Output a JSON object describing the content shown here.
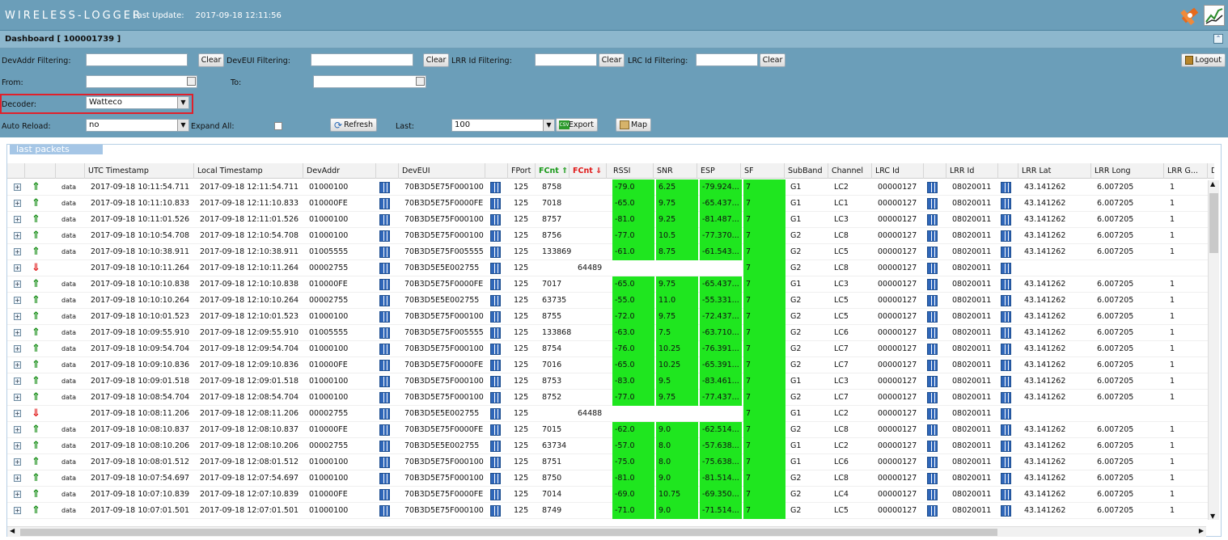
{
  "app": {
    "title": "WIRELESS-LOGGER",
    "last_update_label": "Last Update:",
    "last_update_value": "2017-09-18 12:11:56"
  },
  "dashboard": {
    "title": "Dashboard [ 100001739 ]"
  },
  "filters": {
    "devaddr_label": "DevAddr Filtering:",
    "devaddr_value": "",
    "deveui_label": "DevEUI Filtering:",
    "deveui_value": "",
    "lrr_label": "LRR Id Filtering:",
    "lrr_value": "",
    "lrc_label": "LRC Id Filtering:",
    "lrc_value": "",
    "clear_label": "Clear",
    "logout_label": "Logout",
    "from_label": "From:",
    "from_value": "",
    "to_label": "To:",
    "to_value": "",
    "decoder_label": "Decoder:",
    "decoder_value": "Watteco",
    "auto_reload_label": "Auto Reload:",
    "auto_reload_value": "no",
    "expand_all_label": "Expand All:",
    "refresh_label": "Refresh",
    "last_label": "Last:",
    "last_value": "100",
    "export_label": "Export",
    "map_label": "Map"
  },
  "panel": {
    "title": "last packets"
  },
  "columns": [
    "UTC Timestamp",
    "Local Timestamp",
    "DevAddr",
    "DevEUI",
    "FPort",
    "FCnt ⇑",
    "FCnt ⇓",
    "RSSI",
    "SNR",
    "ESP",
    "SF",
    "SubBand",
    "Channel",
    "LRC Id",
    "LRR Id",
    "LRR Lat",
    "LRR Long",
    "LRR G...",
    "Dev"
  ],
  "rows": [
    {
      "dir": "up",
      "tag": "data",
      "utc": "2017-09-18 10:11:54.711",
      "local": "2017-09-18 12:11:54.711",
      "devaddr": "01000100",
      "deveui": "70B3D5E75F000100",
      "fport": "125",
      "fcnt_up": "8758",
      "fcnt_down": "",
      "rssi": "-79.0",
      "snr": "6.25",
      "esp": "-79.924...",
      "sf": "7",
      "subband": "G1",
      "channel": "LC2",
      "lrc": "00000127",
      "lrr": "08020011",
      "lat": "43.141262",
      "lon": "6.007205",
      "lrrg": "1"
    },
    {
      "dir": "up",
      "tag": "data",
      "utc": "2017-09-18 10:11:10.833",
      "local": "2017-09-18 12:11:10.833",
      "devaddr": "010000FE",
      "deveui": "70B3D5E75F0000FE",
      "fport": "125",
      "fcnt_up": "7018",
      "fcnt_down": "",
      "rssi": "-65.0",
      "snr": "9.75",
      "esp": "-65.437...",
      "sf": "7",
      "subband": "G1",
      "channel": "LC1",
      "lrc": "00000127",
      "lrr": "08020011",
      "lat": "43.141262",
      "lon": "6.007205",
      "lrrg": "1"
    },
    {
      "dir": "up",
      "tag": "data",
      "utc": "2017-09-18 10:11:01.526",
      "local": "2017-09-18 12:11:01.526",
      "devaddr": "01000100",
      "deveui": "70B3D5E75F000100",
      "fport": "125",
      "fcnt_up": "8757",
      "fcnt_down": "",
      "rssi": "-81.0",
      "snr": "9.25",
      "esp": "-81.487...",
      "sf": "7",
      "subband": "G1",
      "channel": "LC3",
      "lrc": "00000127",
      "lrr": "08020011",
      "lat": "43.141262",
      "lon": "6.007205",
      "lrrg": "1"
    },
    {
      "dir": "up",
      "tag": "data",
      "utc": "2017-09-18 10:10:54.708",
      "local": "2017-09-18 12:10:54.708",
      "devaddr": "01000100",
      "deveui": "70B3D5E75F000100",
      "fport": "125",
      "fcnt_up": "8756",
      "fcnt_down": "",
      "rssi": "-77.0",
      "snr": "10.5",
      "esp": "-77.370...",
      "sf": "7",
      "subband": "G2",
      "channel": "LC8",
      "lrc": "00000127",
      "lrr": "08020011",
      "lat": "43.141262",
      "lon": "6.007205",
      "lrrg": "1"
    },
    {
      "dir": "up",
      "tag": "data",
      "utc": "2017-09-18 10:10:38.911",
      "local": "2017-09-18 12:10:38.911",
      "devaddr": "01005555",
      "deveui": "70B3D5E75F005555",
      "fport": "125",
      "fcnt_up": "133869",
      "fcnt_down": "",
      "rssi": "-61.0",
      "snr": "8.75",
      "esp": "-61.543...",
      "sf": "7",
      "subband": "G2",
      "channel": "LC5",
      "lrc": "00000127",
      "lrr": "08020011",
      "lat": "43.141262",
      "lon": "6.007205",
      "lrrg": "1"
    },
    {
      "dir": "down",
      "tag": "",
      "utc": "2017-09-18 10:10:11.264",
      "local": "2017-09-18 12:10:11.264",
      "devaddr": "00002755",
      "deveui": "70B3D5E5E002755",
      "fport": "125",
      "fcnt_up": "",
      "fcnt_down": "64489",
      "rssi": "",
      "snr": "",
      "esp": "",
      "sf": "7",
      "subband": "G2",
      "channel": "LC8",
      "lrc": "00000127",
      "lrr": "08020011",
      "lat": "",
      "lon": "",
      "lrrg": ""
    },
    {
      "dir": "up",
      "tag": "data",
      "utc": "2017-09-18 10:10:10.838",
      "local": "2017-09-18 12:10:10.838",
      "devaddr": "010000FE",
      "deveui": "70B3D5E75F0000FE",
      "fport": "125",
      "fcnt_up": "7017",
      "fcnt_down": "",
      "rssi": "-65.0",
      "snr": "9.75",
      "esp": "-65.437...",
      "sf": "7",
      "subband": "G1",
      "channel": "LC3",
      "lrc": "00000127",
      "lrr": "08020011",
      "lat": "43.141262",
      "lon": "6.007205",
      "lrrg": "1"
    },
    {
      "dir": "up",
      "tag": "data",
      "utc": "2017-09-18 10:10:10.264",
      "local": "2017-09-18 12:10:10.264",
      "devaddr": "00002755",
      "deveui": "70B3D5E5E002755",
      "fport": "125",
      "fcnt_up": "63735",
      "fcnt_down": "",
      "rssi": "-55.0",
      "snr": "11.0",
      "esp": "-55.331...",
      "sf": "7",
      "subband": "G2",
      "channel": "LC5",
      "lrc": "00000127",
      "lrr": "08020011",
      "lat": "43.141262",
      "lon": "6.007205",
      "lrrg": "1"
    },
    {
      "dir": "up",
      "tag": "data",
      "utc": "2017-09-18 10:10:01.523",
      "local": "2017-09-18 12:10:01.523",
      "devaddr": "01000100",
      "deveui": "70B3D5E75F000100",
      "fport": "125",
      "fcnt_up": "8755",
      "fcnt_down": "",
      "rssi": "-72.0",
      "snr": "9.75",
      "esp": "-72.437...",
      "sf": "7",
      "subband": "G2",
      "channel": "LC5",
      "lrc": "00000127",
      "lrr": "08020011",
      "lat": "43.141262",
      "lon": "6.007205",
      "lrrg": "1"
    },
    {
      "dir": "up",
      "tag": "data",
      "utc": "2017-09-18 10:09:55.910",
      "local": "2017-09-18 12:09:55.910",
      "devaddr": "01005555",
      "deveui": "70B3D5E75F005555",
      "fport": "125",
      "fcnt_up": "133868",
      "fcnt_down": "",
      "rssi": "-63.0",
      "snr": "7.5",
      "esp": "-63.710...",
      "sf": "7",
      "subband": "G2",
      "channel": "LC6",
      "lrc": "00000127",
      "lrr": "08020011",
      "lat": "43.141262",
      "lon": "6.007205",
      "lrrg": "1"
    },
    {
      "dir": "up",
      "tag": "data",
      "utc": "2017-09-18 10:09:54.704",
      "local": "2017-09-18 12:09:54.704",
      "devaddr": "01000100",
      "deveui": "70B3D5E75F000100",
      "fport": "125",
      "fcnt_up": "8754",
      "fcnt_down": "",
      "rssi": "-76.0",
      "snr": "10.25",
      "esp": "-76.391...",
      "sf": "7",
      "subband": "G2",
      "channel": "LC7",
      "lrc": "00000127",
      "lrr": "08020011",
      "lat": "43.141262",
      "lon": "6.007205",
      "lrrg": "1"
    },
    {
      "dir": "up",
      "tag": "data",
      "utc": "2017-09-18 10:09:10.836",
      "local": "2017-09-18 12:09:10.836",
      "devaddr": "010000FE",
      "deveui": "70B3D5E75F0000FE",
      "fport": "125",
      "fcnt_up": "7016",
      "fcnt_down": "",
      "rssi": "-65.0",
      "snr": "10.25",
      "esp": "-65.391...",
      "sf": "7",
      "subband": "G2",
      "channel": "LC7",
      "lrc": "00000127",
      "lrr": "08020011",
      "lat": "43.141262",
      "lon": "6.007205",
      "lrrg": "1"
    },
    {
      "dir": "up",
      "tag": "data",
      "utc": "2017-09-18 10:09:01.518",
      "local": "2017-09-18 12:09:01.518",
      "devaddr": "01000100",
      "deveui": "70B3D5E75F000100",
      "fport": "125",
      "fcnt_up": "8753",
      "fcnt_down": "",
      "rssi": "-83.0",
      "snr": "9.5",
      "esp": "-83.461...",
      "sf": "7",
      "subband": "G1",
      "channel": "LC3",
      "lrc": "00000127",
      "lrr": "08020011",
      "lat": "43.141262",
      "lon": "6.007205",
      "lrrg": "1"
    },
    {
      "dir": "up",
      "tag": "data",
      "utc": "2017-09-18 10:08:54.704",
      "local": "2017-09-18 12:08:54.704",
      "devaddr": "01000100",
      "deveui": "70B3D5E75F000100",
      "fport": "125",
      "fcnt_up": "8752",
      "fcnt_down": "",
      "rssi": "-77.0",
      "snr": "9.75",
      "esp": "-77.437...",
      "sf": "7",
      "subband": "G2",
      "channel": "LC7",
      "lrc": "00000127",
      "lrr": "08020011",
      "lat": "43.141262",
      "lon": "6.007205",
      "lrrg": "1"
    },
    {
      "dir": "down",
      "tag": "",
      "utc": "2017-09-18 10:08:11.206",
      "local": "2017-09-18 12:08:11.206",
      "devaddr": "00002755",
      "deveui": "70B3D5E5E002755",
      "fport": "125",
      "fcnt_up": "",
      "fcnt_down": "64488",
      "rssi": "",
      "snr": "",
      "esp": "",
      "sf": "7",
      "subband": "G1",
      "channel": "LC2",
      "lrc": "00000127",
      "lrr": "08020011",
      "lat": "",
      "lon": "",
      "lrrg": ""
    },
    {
      "dir": "up",
      "tag": "data",
      "utc": "2017-09-18 10:08:10.837",
      "local": "2017-09-18 12:08:10.837",
      "devaddr": "010000FE",
      "deveui": "70B3D5E75F0000FE",
      "fport": "125",
      "fcnt_up": "7015",
      "fcnt_down": "",
      "rssi": "-62.0",
      "snr": "9.0",
      "esp": "-62.514...",
      "sf": "7",
      "subband": "G2",
      "channel": "LC8",
      "lrc": "00000127",
      "lrr": "08020011",
      "lat": "43.141262",
      "lon": "6.007205",
      "lrrg": "1"
    },
    {
      "dir": "up",
      "tag": "data",
      "utc": "2017-09-18 10:08:10.206",
      "local": "2017-09-18 12:08:10.206",
      "devaddr": "00002755",
      "deveui": "70B3D5E5E002755",
      "fport": "125",
      "fcnt_up": "63734",
      "fcnt_down": "",
      "rssi": "-57.0",
      "snr": "8.0",
      "esp": "-57.638...",
      "sf": "7",
      "subband": "G1",
      "channel": "LC2",
      "lrc": "00000127",
      "lrr": "08020011",
      "lat": "43.141262",
      "lon": "6.007205",
      "lrrg": "1"
    },
    {
      "dir": "up",
      "tag": "data",
      "utc": "2017-09-18 10:08:01.512",
      "local": "2017-09-18 12:08:01.512",
      "devaddr": "01000100",
      "deveui": "70B3D5E75F000100",
      "fport": "125",
      "fcnt_up": "8751",
      "fcnt_down": "",
      "rssi": "-75.0",
      "snr": "8.0",
      "esp": "-75.638...",
      "sf": "7",
      "subband": "G1",
      "channel": "LC6",
      "lrc": "00000127",
      "lrr": "08020011",
      "lat": "43.141262",
      "lon": "6.007205",
      "lrrg": "1"
    },
    {
      "dir": "up",
      "tag": "data",
      "utc": "2017-09-18 10:07:54.697",
      "local": "2017-09-18 12:07:54.697",
      "devaddr": "01000100",
      "deveui": "70B3D5E75F000100",
      "fport": "125",
      "fcnt_up": "8750",
      "fcnt_down": "",
      "rssi": "-81.0",
      "snr": "9.0",
      "esp": "-81.514...",
      "sf": "7",
      "subband": "G2",
      "channel": "LC8",
      "lrc": "00000127",
      "lrr": "08020011",
      "lat": "43.141262",
      "lon": "6.007205",
      "lrrg": "1"
    },
    {
      "dir": "up",
      "tag": "data",
      "utc": "2017-09-18 10:07:10.839",
      "local": "2017-09-18 12:07:10.839",
      "devaddr": "010000FE",
      "deveui": "70B3D5E75F0000FE",
      "fport": "125",
      "fcnt_up": "7014",
      "fcnt_down": "",
      "rssi": "-69.0",
      "snr": "10.75",
      "esp": "-69.350...",
      "sf": "7",
      "subband": "G2",
      "channel": "LC4",
      "lrc": "00000127",
      "lrr": "08020011",
      "lat": "43.141262",
      "lon": "6.007205",
      "lrrg": "1"
    },
    {
      "dir": "up",
      "tag": "data",
      "utc": "2017-09-18 10:07:01.501",
      "local": "2017-09-18 12:07:01.501",
      "devaddr": "01000100",
      "deveui": "70B3D5E75F000100",
      "fport": "125",
      "fcnt_up": "8749",
      "fcnt_down": "",
      "rssi": "-71.0",
      "snr": "9.0",
      "esp": "-71.514...",
      "sf": "7",
      "subband": "G2",
      "channel": "LC5",
      "lrc": "00000127",
      "lrr": "08020011",
      "lat": "43.141262",
      "lon": "6.007205",
      "lrrg": "1"
    }
  ]
}
